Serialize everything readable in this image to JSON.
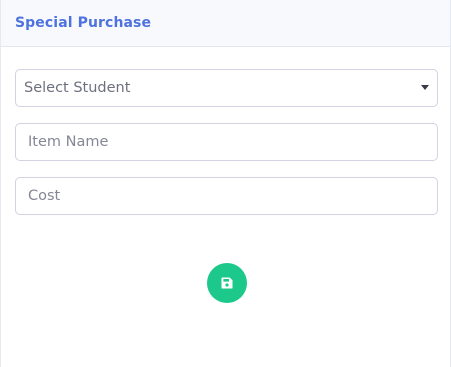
{
  "header": {
    "title": "Special Purchase"
  },
  "form": {
    "student_select": {
      "selected": "Select Student"
    },
    "item_name": {
      "value": "",
      "placeholder": "Item Name"
    },
    "cost": {
      "value": "",
      "placeholder": "Cost"
    }
  },
  "actions": {
    "save_icon": "floppy-disk-icon"
  },
  "colors": {
    "title": "#4e73df",
    "header_bg": "#f8f9fc",
    "save_button": "#1cc88a"
  }
}
